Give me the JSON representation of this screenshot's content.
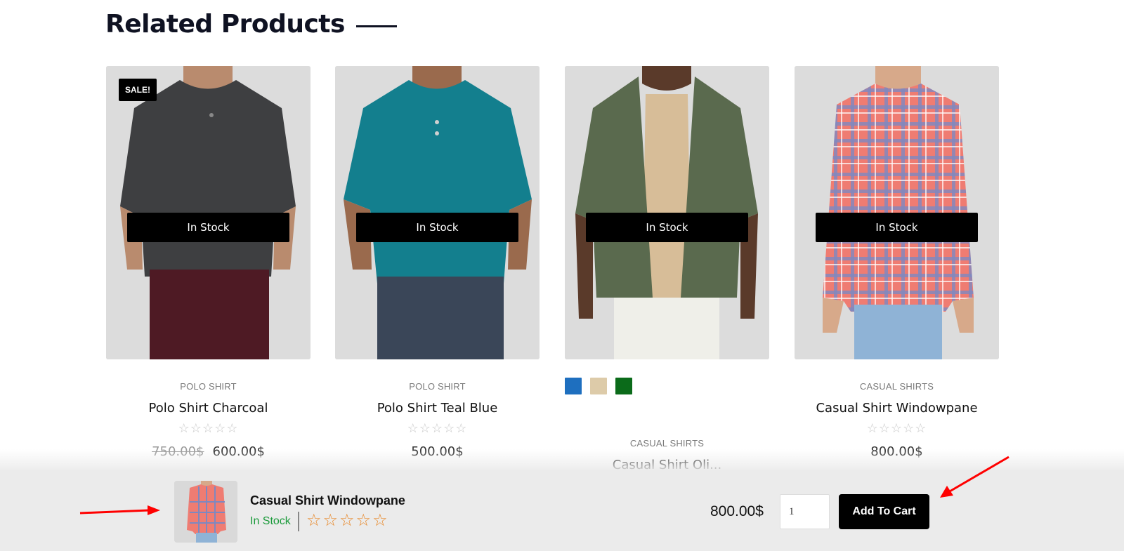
{
  "section": {
    "title": "Related Products"
  },
  "products": [
    {
      "image": "charcoal-polo-shirt-photo",
      "sale_badge": "SALE!",
      "stock_label": "In Stock",
      "category": "POLO SHIRT",
      "name": "Polo Shirt Charcoal",
      "rating": 0,
      "rating_max": 5,
      "price_old": "750.00$",
      "price": "600.00$"
    },
    {
      "image": "teal-polo-shirt-photo",
      "stock_label": "In Stock",
      "category": "POLO SHIRT",
      "name": "Polo Shirt Teal Blue",
      "rating": 0,
      "rating_max": 5,
      "price": "500.00$"
    },
    {
      "image": "olive-casual-shirt-photo",
      "stock_label": "In Stock",
      "swatches": [
        {
          "name": "blue",
          "color": "#1e6fbf"
        },
        {
          "name": "beige",
          "color": "#ddcba9"
        },
        {
          "name": "green",
          "color": "#0b6b1a"
        }
      ],
      "category": "CASUAL SHIRTS",
      "name": "Casual Shirt Oli..."
    },
    {
      "image": "windowpane-casual-shirt-photo",
      "stock_label": "In Stock",
      "category": "CASUAL SHIRTS",
      "name": "Casual Shirt Windowpane",
      "rating": 0,
      "rating_max": 5,
      "price": "800.00$"
    }
  ],
  "sticky_cart": {
    "product_name": "Casual Shirt Windowpane",
    "status": "In Stock",
    "rating": 0,
    "rating_max": 5,
    "price": "800.00$",
    "quantity": "1",
    "add_to_cart_label": "Add To Cart"
  },
  "colors": {
    "accent": "#000000",
    "in_stock_green": "#1a9a3a",
    "sticky_star_orange": "#e8892b",
    "annotation_red": "#ff0000"
  }
}
